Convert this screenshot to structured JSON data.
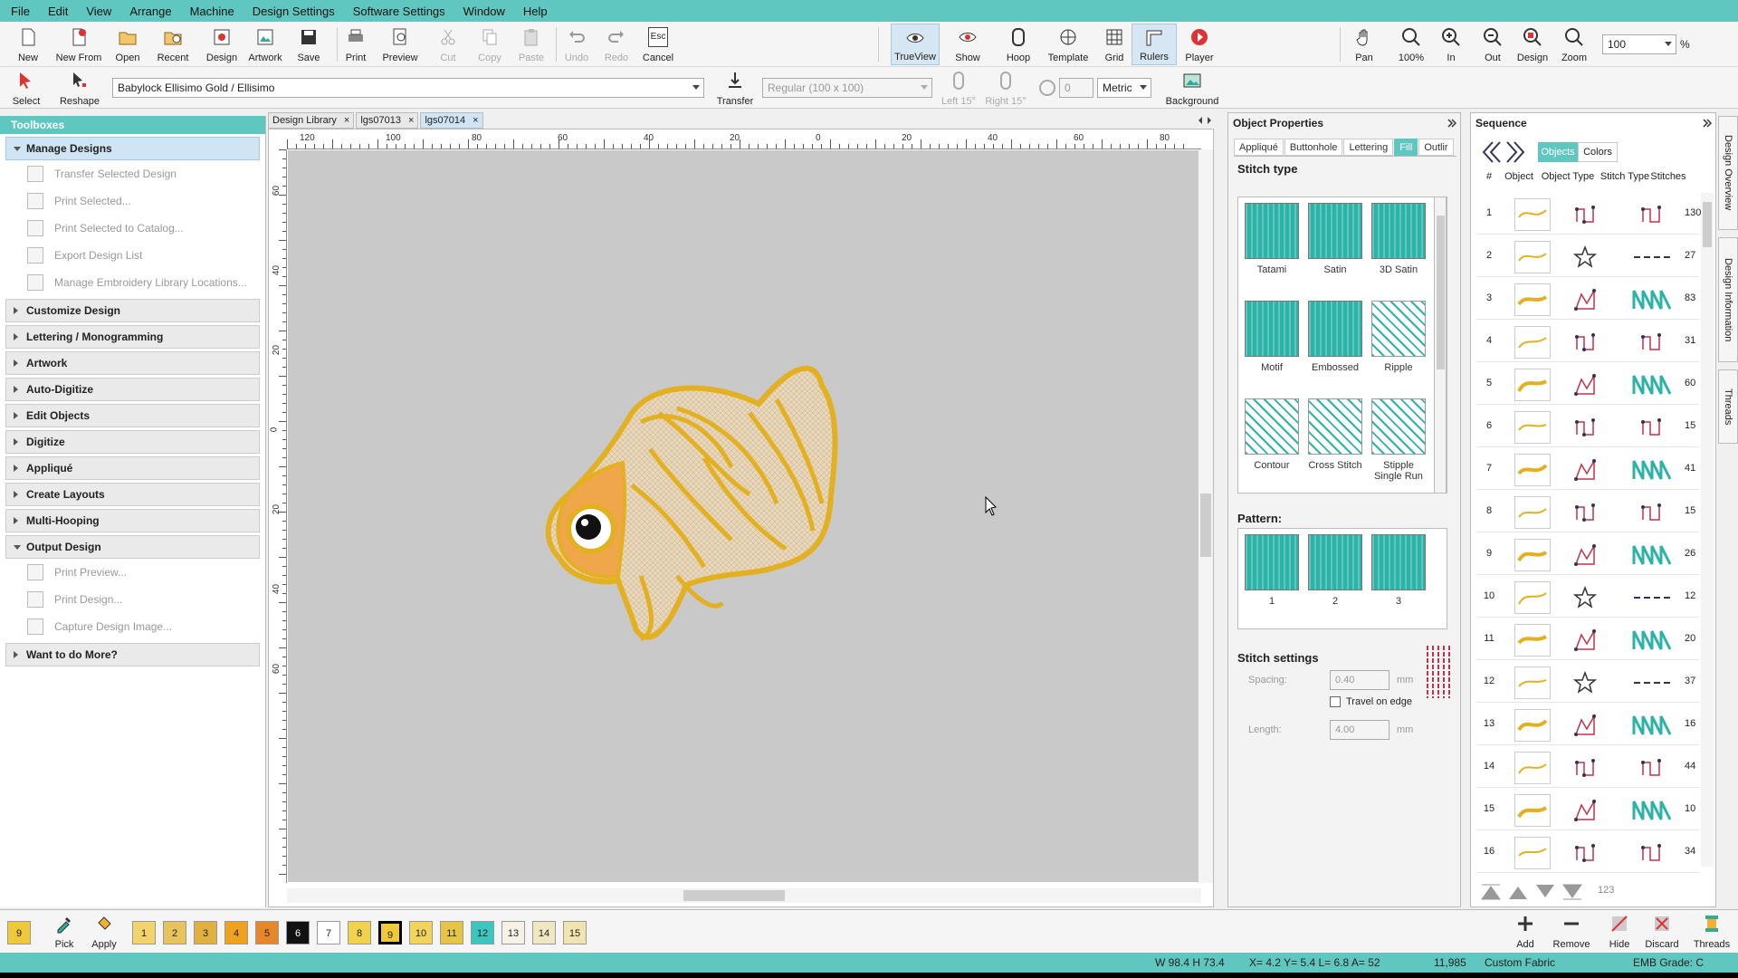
{
  "menu": [
    "File",
    "Edit",
    "View",
    "Arrange",
    "Machine",
    "Design Settings",
    "Software Settings",
    "Window",
    "Help"
  ],
  "toolbar": {
    "new": "New",
    "new_from": "New From",
    "open": "Open",
    "recent": "Recent",
    "design": "Design",
    "artwork": "Artwork",
    "save": "Save",
    "print": "Print",
    "preview": "Preview",
    "cut": "Cut",
    "copy": "Copy",
    "paste": "Paste",
    "undo": "Undo",
    "redo": "Redo",
    "cancel": "Cancel",
    "esc": "Esc",
    "trueview": "TrueView",
    "show": "Show",
    "hoop": "Hoop",
    "template": "Template",
    "grid": "Grid",
    "rulers": "Rulers",
    "player": "Player",
    "pan": "Pan",
    "zoom100": "100%",
    "zoom_in": "In",
    "zoom_out": "Out",
    "zoom_design": "Design",
    "zoom": "Zoom",
    "zoom_value": "100",
    "percent": "%"
  },
  "toolbar2": {
    "select": "Select",
    "reshape": "Reshape",
    "thread_chart": "Babylock Ellisimo Gold / Ellisimo",
    "transfer": "Transfer",
    "hoop_size": "Regular (100 x 100)",
    "left15": "Left 15°",
    "right15": "Right 15°",
    "rotate_value": "0",
    "units": "Metric",
    "background": "Background"
  },
  "toolboxes": {
    "title": "Toolboxes",
    "manage": "Manage Designs",
    "manage_items": [
      "Transfer Selected Design",
      "Print Selected...",
      "Print Selected to Catalog...",
      "Export Design List",
      "Manage Embroidery Library Locations..."
    ],
    "sections": [
      "Customize Design",
      "Lettering / Monogramming",
      "Artwork",
      "Auto-Digitize",
      "Edit Objects",
      "Digitize",
      "Appliqué",
      "Create Layouts",
      "Multi-Hooping"
    ],
    "output": "Output Design",
    "output_items": [
      "Print Preview...",
      "Print Design...",
      "Capture Design Image..."
    ],
    "more": "Want to do More?"
  },
  "doc_tabs": [
    {
      "label": "Design Library",
      "selected": false
    },
    {
      "label": "lgs07013",
      "selected": false
    },
    {
      "label": "lgs07014",
      "selected": true
    }
  ],
  "ruler_h": [
    "120",
    "100",
    "80",
    "60",
    "40",
    "20",
    "0",
    "20",
    "40",
    "60",
    "80"
  ],
  "ruler_v": [
    "60",
    "40",
    "20",
    "0",
    "20",
    "40",
    "60"
  ],
  "object_properties": {
    "title": "Object Properties",
    "tabs": [
      "Appliqué",
      "Buttonhole",
      "Lettering",
      "Fill",
      "Outlir"
    ],
    "stitch_type_label": "Stitch type",
    "stitch_types": [
      "Tatami",
      "Satin",
      "3D Satin",
      "Motif",
      "Embossed",
      "Ripple",
      "Contour",
      "Cross Stitch",
      "Stipple Single Run"
    ],
    "pattern_label": "Pattern:",
    "patterns": [
      "1",
      "2",
      "3"
    ],
    "settings_label": "Stitch settings",
    "spacing_label": "Spacing:",
    "spacing_value": "0.40",
    "mm": "mm",
    "travel_label": "Travel on edge",
    "length_label": "Length:",
    "length_value": "4.00"
  },
  "sequence": {
    "title": "Sequence",
    "tab_objects": "Objects",
    "tab_colors": "Colors",
    "headers": [
      "#",
      "Object",
      "Object Type",
      "Stitch Type",
      "Stitches"
    ],
    "rows": [
      {
        "n": "1",
        "type": "run",
        "stitch": "run",
        "count": "130"
      },
      {
        "n": "2",
        "type": "star",
        "stitch": "dash",
        "count": "27"
      },
      {
        "n": "3",
        "type": "fill",
        "stitch": "zig",
        "count": "83"
      },
      {
        "n": "4",
        "type": "run",
        "stitch": "run",
        "count": "31"
      },
      {
        "n": "5",
        "type": "fill",
        "stitch": "zig",
        "count": "60"
      },
      {
        "n": "6",
        "type": "run",
        "stitch": "run",
        "count": "15"
      },
      {
        "n": "7",
        "type": "fill",
        "stitch": "zig",
        "count": "41"
      },
      {
        "n": "8",
        "type": "run",
        "stitch": "run",
        "count": "15"
      },
      {
        "n": "9",
        "type": "fill",
        "stitch": "zig",
        "count": "26"
      },
      {
        "n": "10",
        "type": "star",
        "stitch": "dash",
        "count": "12"
      },
      {
        "n": "11",
        "type": "fill",
        "stitch": "zig",
        "count": "20"
      },
      {
        "n": "12",
        "type": "star",
        "stitch": "dash",
        "count": "37"
      },
      {
        "n": "13",
        "type": "fill",
        "stitch": "zig",
        "count": "16"
      },
      {
        "n": "14",
        "type": "run",
        "stitch": "run",
        "count": "44"
      },
      {
        "n": "15",
        "type": "fill",
        "stitch": "zig",
        "count": "10"
      },
      {
        "n": "16",
        "type": "run",
        "stitch": "run",
        "count": "34"
      }
    ],
    "add": "Add",
    "remove": "Remove",
    "hide": "Hide",
    "discard": "Discard",
    "threads": "Threads",
    "num_badge": "123"
  },
  "side_tabs": [
    "Design Overview",
    "Design Information",
    "Threads"
  ],
  "palette": {
    "current": "9",
    "pick": "Pick",
    "apply": "Apply",
    "colors": [
      {
        "n": "1",
        "c": "#f3d36b"
      },
      {
        "n": "2",
        "c": "#e8c25a"
      },
      {
        "n": "3",
        "c": "#e0b13e"
      },
      {
        "n": "4",
        "c": "#f0a21e"
      },
      {
        "n": "5",
        "c": "#e8872a"
      },
      {
        "n": "6",
        "c": "#111111"
      },
      {
        "n": "7",
        "c": "#ffffff"
      },
      {
        "n": "8",
        "c": "#f2d24a"
      },
      {
        "n": "9",
        "c": "#f0c93a"
      },
      {
        "n": "10",
        "c": "#f3d45a"
      },
      {
        "n": "11",
        "c": "#e6c544"
      },
      {
        "n": "12",
        "c": "#3cc6c0"
      },
      {
        "n": "13",
        "c": "#f6f2e6"
      },
      {
        "n": "14",
        "c": "#efe6c2"
      },
      {
        "n": "15",
        "c": "#f2e4b0"
      }
    ]
  },
  "status": {
    "size": "W  98.4 H  73.4",
    "coords": "X=  4.2 Y=   5.4 L=   6.8 A=  52",
    "stitches": "11,985",
    "fabric": "Custom Fabric",
    "grade": "EMB Grade: C"
  },
  "colors": {
    "accent": "#5fc7c0",
    "stitch_teal": "#2bb3a8",
    "thread_gold": "#e3b021"
  }
}
